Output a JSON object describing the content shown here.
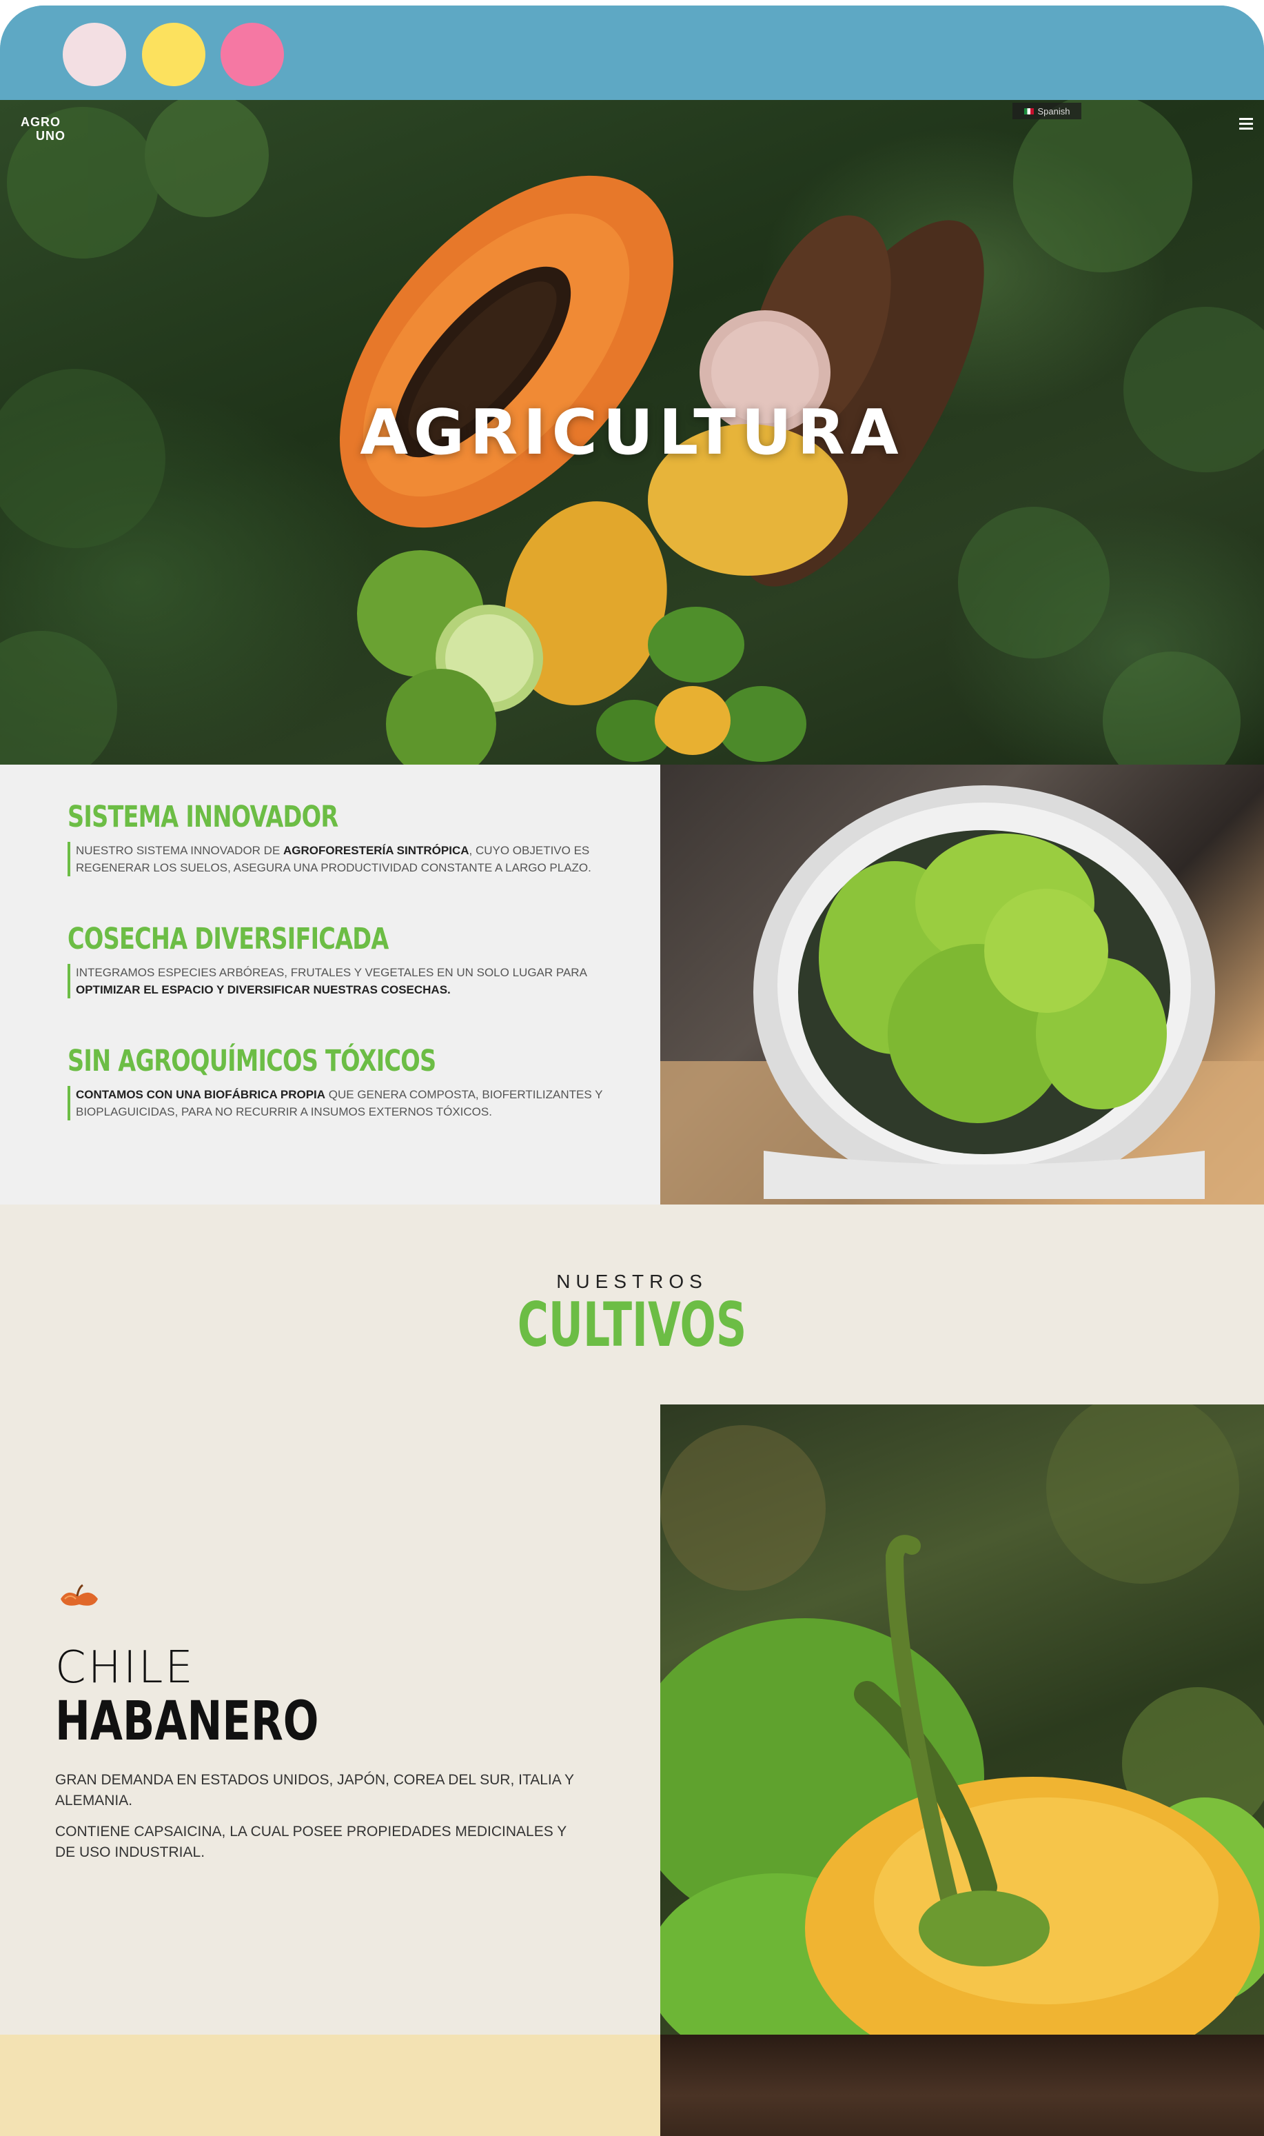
{
  "window": {
    "dots": [
      "#f3dfe3",
      "#fce15e",
      "#f578a3"
    ]
  },
  "header": {
    "logo_line1": "AGRO",
    "logo_line2": "UNO",
    "language_label": "Spanish",
    "menu_icon": "hamburger-menu-icon"
  },
  "hero": {
    "title": "AGRICULTURA"
  },
  "features": [
    {
      "title": "SISTEMA INNOVADOR",
      "text_before": "NUESTRO SISTEMA INNOVADOR DE ",
      "text_bold": "AGROFORESTERÍA SINTRÓPICA",
      "text_after": ", CUYO OBJETIVO ES REGENERAR LOS SUELOS, ASEGURA UNA PRODUCTIVIDAD CONSTANTE A LARGO PLAZO."
    },
    {
      "title": "COSECHA DIVERSIFICADA",
      "text_before": "INTEGRAMOS ESPECIES ARBÓREAS, FRUTALES Y VEGETALES EN UN SOLO LUGAR PARA ",
      "text_bold": "OPTIMIZAR EL ESPACIO Y DIVERSIFICAR NUESTRAS COSECHAS.",
      "text_after": ""
    },
    {
      "title": "SIN AGROQUÍMICOS TÓXICOS",
      "text_before": "",
      "text_bold": "CONTAMOS CON UNA BIOFÁBRICA PROPIA",
      "text_after": " QUE GENERA COMPOSTA, BIOFERTILIZANTES Y BIOPLAGUICIDAS, PARA NO RECURRIR A INSUMOS EXTERNOS TÓXICOS."
    }
  ],
  "cultivos": {
    "eyebrow": "NUESTROS",
    "title": "CULTIVOS",
    "crop": {
      "icon": "chili-pepper-icon",
      "name_line1": "CHILE",
      "name_line2": "HABANERO",
      "paragraph1": "GRAN DEMANDA EN ESTADOS UNIDOS, JAPÓN, COREA DEL SUR, ITALIA Y ALEMANIA.",
      "paragraph2": "CONTIENE CAPSAICINA, LA CUAL POSEE PROPIEDADES MEDICINALES Y DE USO INDUSTRIAL."
    }
  },
  "colors": {
    "accent_green": "#6cbd45",
    "titlebar_blue": "#5ea8c4",
    "cream": "#eeeae1",
    "sand": "#f3e2b3"
  }
}
